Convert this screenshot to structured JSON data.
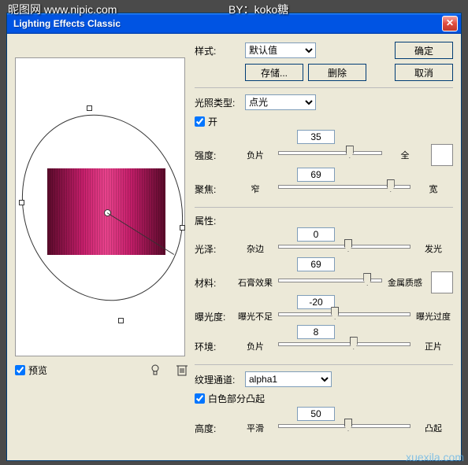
{
  "watermarks": {
    "top_left": "昵图网 www.nipic.com",
    "top_right": "BY：koko糖",
    "bottom_right": "xuexila.com"
  },
  "dialog": {
    "title": "Lighting Effects Classic",
    "close": "✕"
  },
  "style_row": {
    "label": "样式:",
    "value": "默认值",
    "save_btn": "存储...",
    "delete_btn": "删除",
    "ok_btn": "确定",
    "cancel_btn": "取消"
  },
  "light_type": {
    "label": "光照类型:",
    "value": "点光",
    "on_label": "开",
    "on_checked": true
  },
  "sliders": {
    "intensity": {
      "label": "强度:",
      "left": "负片",
      "right": "全",
      "value": "35",
      "pos": 65
    },
    "focus": {
      "label": "聚焦:",
      "left": "窄",
      "right": "宽",
      "value": "69",
      "pos": 82
    },
    "gloss": {
      "label": "光泽:",
      "left": "杂边",
      "right": "发光",
      "value": "0",
      "pos": 50
    },
    "material": {
      "label": "材料:",
      "left": "石膏效果",
      "right": "金属质感",
      "value": "69",
      "pos": 82
    },
    "exposure": {
      "label": "曝光度:",
      "left": "曝光不足",
      "right": "曝光过度",
      "value": "-20",
      "pos": 40
    },
    "ambience": {
      "label": "环境:",
      "left": "负片",
      "right": "正片",
      "value": "8",
      "pos": 54
    },
    "height": {
      "label": "高度:",
      "left": "平滑",
      "right": "凸起",
      "value": "50",
      "pos": 50
    }
  },
  "properties_label": "属性:",
  "texture": {
    "label": "纹理通道:",
    "value": "alpha1",
    "white_high_label": "白色部分凸起",
    "white_high_checked": true
  },
  "preview": {
    "label": "预览",
    "checked": true
  }
}
